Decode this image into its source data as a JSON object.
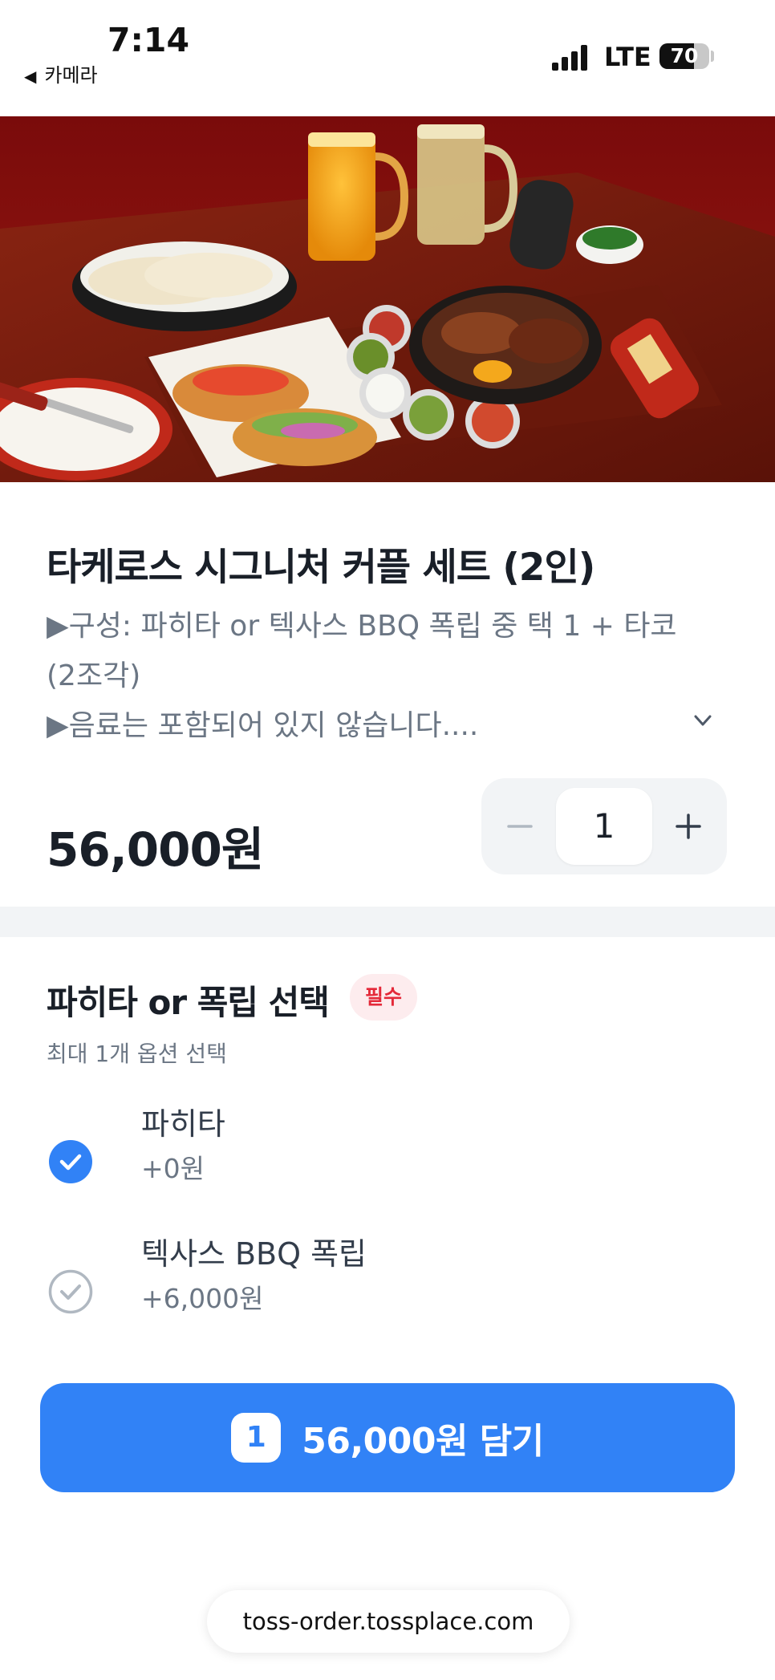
{
  "status_bar": {
    "time": "7:14",
    "back_app": "카메라",
    "network": "LTE",
    "battery": "70",
    "battery_level": 0.7
  },
  "product": {
    "image_alt": "fajita tacos set photo",
    "title": "타케로스 시그니처 커플 세트 (2인)",
    "description_lines": [
      "▶구성: 파히타 or 텍사스 BBQ 폭립 중 택 1 + 타코",
      "(2조각)",
      "▶음료는 포함되어 있지 않습니다...."
    ],
    "price": "56,000원",
    "quantity": "1"
  },
  "option_group": {
    "title": "파히타 or 폭립 선택",
    "badge": "필수",
    "subtitle": "최대 1개 옵션 선택",
    "options": [
      {
        "name": "파히타",
        "price": "+0원",
        "selected": true
      },
      {
        "name": "텍사스 BBQ 폭립",
        "price": "+6,000원",
        "selected": false
      }
    ]
  },
  "cta": {
    "count": "1",
    "label": "56,000원 담기"
  },
  "browser": {
    "url": "toss-order.tossplace.com"
  },
  "colors": {
    "primary": "#3182f6",
    "badge_bg": "#fdecee",
    "badge_text": "#e42939",
    "text_main": "#191f28",
    "text_sub": "#6b7684"
  }
}
